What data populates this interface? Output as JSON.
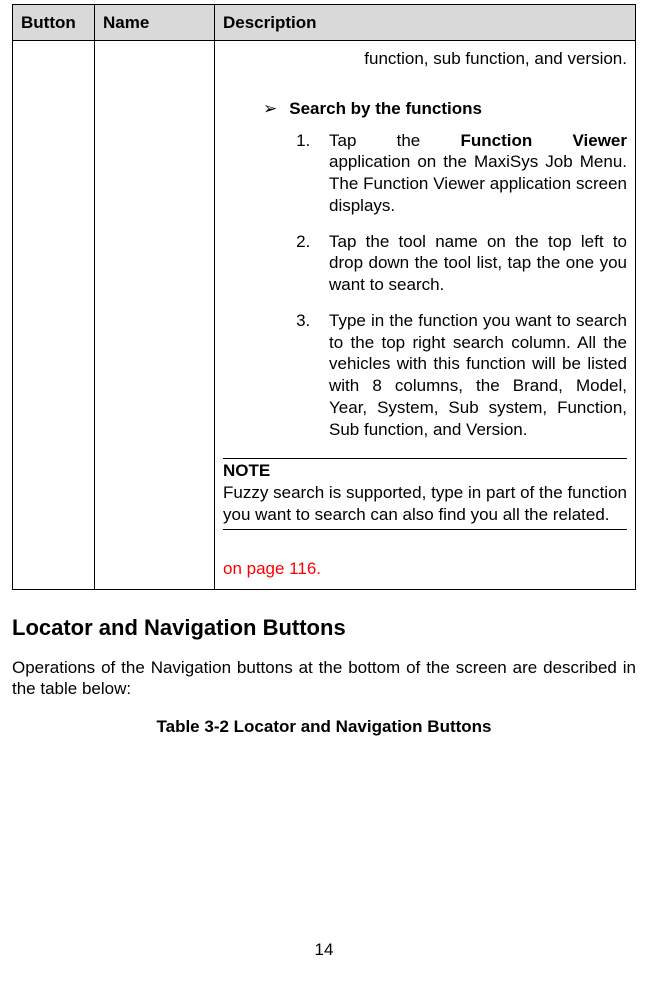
{
  "table": {
    "headers": {
      "button": "Button",
      "name": "Name",
      "desc": "Description"
    },
    "row": {
      "desc": {
        "lead_fragment": "function, sub function, and version.",
        "subhead": "Search by the functions",
        "step1_a": "Tap the ",
        "step1_b": "Function Viewer",
        "step1_c": " application on the MaxiSys Job Menu. The Function Viewer application screen displays.",
        "step2": "Tap the tool name on the top left to drop down the tool list, tap the one you want to search.",
        "step3": "Type in the function you want to search to the top right search column. All the vehicles with this function will be listed with 8 columns, the Brand, Model, Year, System, Sub system, Function, Sub function, and Version.",
        "note_title": "NOTE",
        "note_body": "Fuzzy search is supported, type in part of the function you want to search can also find you all the related.",
        "red_link": "on page 116."
      }
    }
  },
  "section_heading": "Locator and Navigation Buttons",
  "section_para": "Operations of the Navigation buttons at the bottom of the screen are described in the table below:",
  "caption": "Table 3-2 Locator and Navigation Buttons",
  "page_number": "14"
}
